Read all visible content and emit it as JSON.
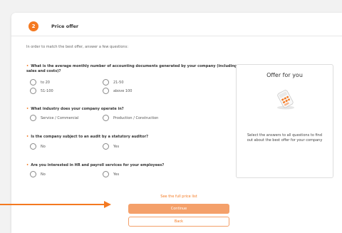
{
  "header": {
    "step_number": "2",
    "title": "Price offer"
  },
  "intro": "In order to match the best offer, answer a few questions:",
  "questions": [
    {
      "text": "What is the average monthly number of accounting documents generated by your company (including sales and costs)?",
      "options": [
        "to 20",
        "21-50",
        "51-100",
        "above 100"
      ]
    },
    {
      "text": "What industry does your company operate in?",
      "options": [
        "Service / Commercial",
        "Production / Construction"
      ]
    },
    {
      "text": "Is the company subject to an audit by a statutory auditor?",
      "options": [
        "No",
        "Yes"
      ]
    },
    {
      "text": "Are you interested in HR and payroll services for your employees?",
      "options": [
        "No",
        "Yes"
      ]
    }
  ],
  "offer_panel": {
    "title": "Offer for you",
    "illustration_icon": "calculator-icon",
    "description": "Select the answers to all questions to find out about the best offer for your company"
  },
  "actions": {
    "price_list_link": "See the full price list",
    "continue_label": "Continue",
    "back_label": "Back"
  },
  "colors": {
    "accent": "#f47920",
    "button_disabled": "#f4a06a"
  }
}
